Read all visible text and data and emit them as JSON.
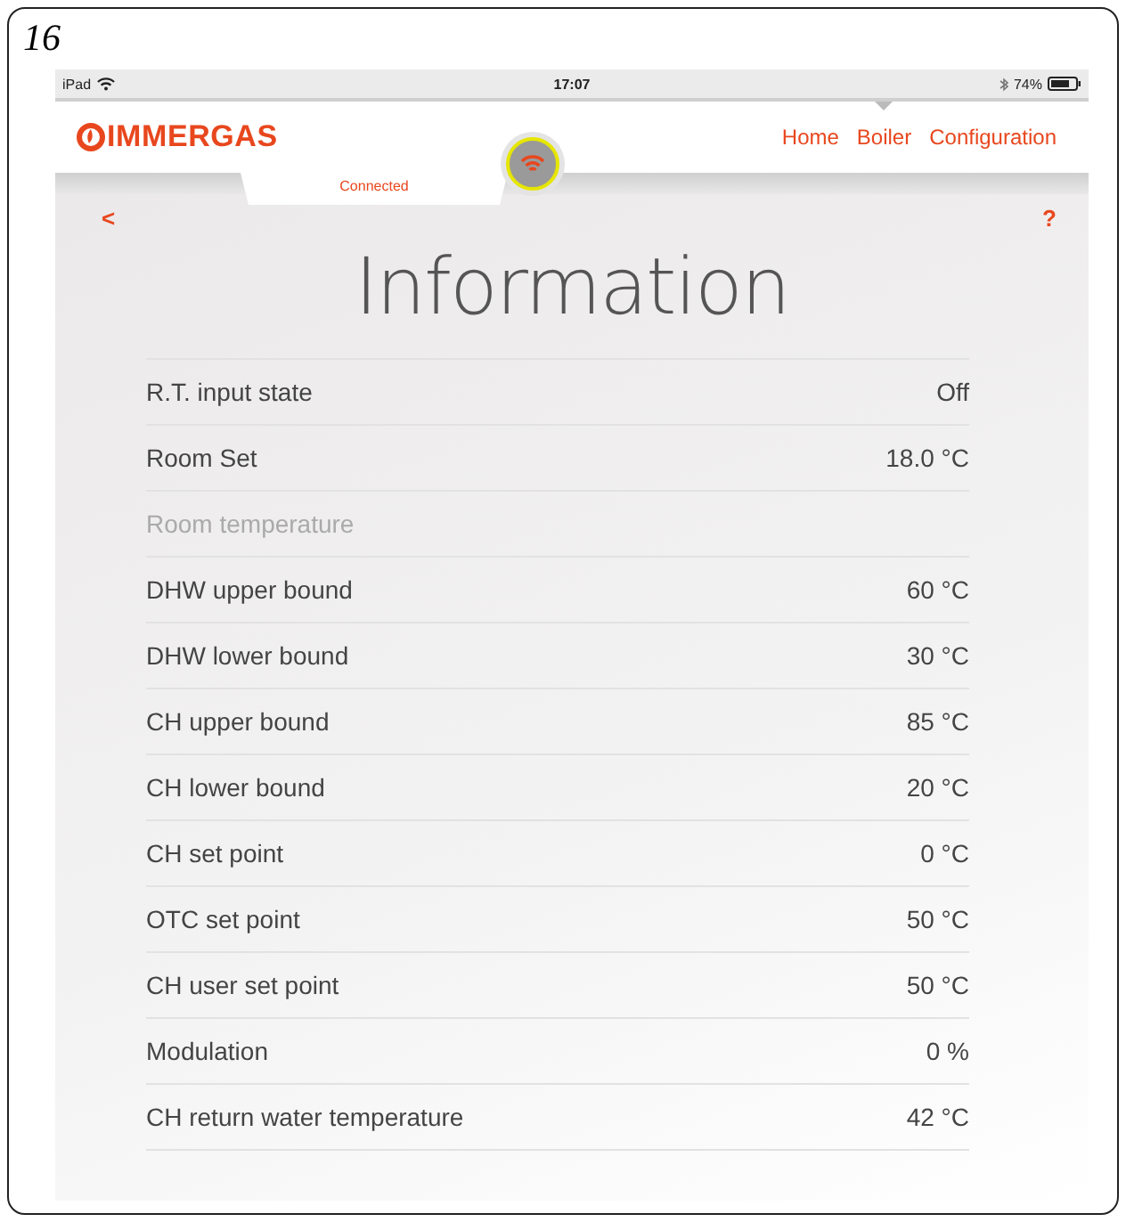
{
  "figure_label": "16",
  "status_bar": {
    "device": "iPad",
    "time": "17:07",
    "battery": "74%"
  },
  "header": {
    "logo": "IMMERGAS",
    "nav": [
      {
        "label": "Home",
        "selected": false
      },
      {
        "label": "Boiler",
        "selected": true
      },
      {
        "label": "Configuration",
        "selected": false
      }
    ]
  },
  "connection": {
    "label": "Connected"
  },
  "toolbar": {
    "back": "<",
    "help": "?"
  },
  "title": "Information",
  "rows": [
    {
      "label": "R.T. input state",
      "value": "Off",
      "disabled": false
    },
    {
      "label": "Room Set",
      "value": "18.0 °C",
      "disabled": false
    },
    {
      "label": "Room temperature",
      "disabled": true
    },
    {
      "label": "DHW upper bound",
      "value": "60 °C",
      "disabled": false
    },
    {
      "label": "DHW lower bound",
      "value": "30 °C",
      "disabled": false
    },
    {
      "label": "CH upper bound",
      "value": "85 °C",
      "disabled": false
    },
    {
      "label": "CH lower bound",
      "value": "20 °C",
      "disabled": false
    },
    {
      "label": "CH set point",
      "value": "0 °C",
      "disabled": false
    },
    {
      "label": "OTC set point",
      "value": "50 °C",
      "disabled": false
    },
    {
      "label": "CH user set point",
      "value": "50 °C",
      "disabled": false
    },
    {
      "label": "Modulation",
      "value": "0 %",
      "disabled": false
    },
    {
      "label": "CH return water temperature",
      "value": "42 °C",
      "disabled": false
    }
  ]
}
